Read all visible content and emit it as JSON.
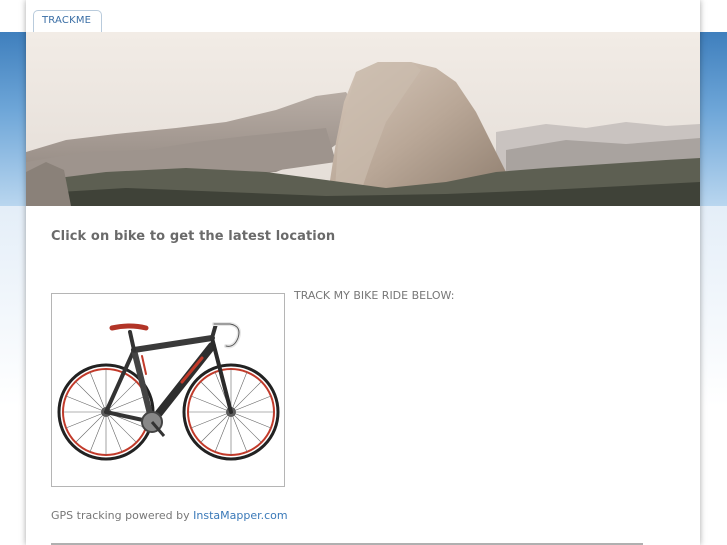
{
  "nav": {
    "tabs": [
      {
        "label": "TRACKME"
      }
    ]
  },
  "main": {
    "heading": "Click on bike to get the latest location",
    "track_label": "TRACK MY BIKE RIDE BELOW:",
    "powered_prefix": "GPS tracking powered by ",
    "powered_link": "InstaMapper.com"
  },
  "colors": {
    "accent": "#3a79b8",
    "band": "#3f7fbd"
  },
  "icons": {
    "bike": "road-bike-image",
    "banner": "half-dome-mountain-banner"
  }
}
